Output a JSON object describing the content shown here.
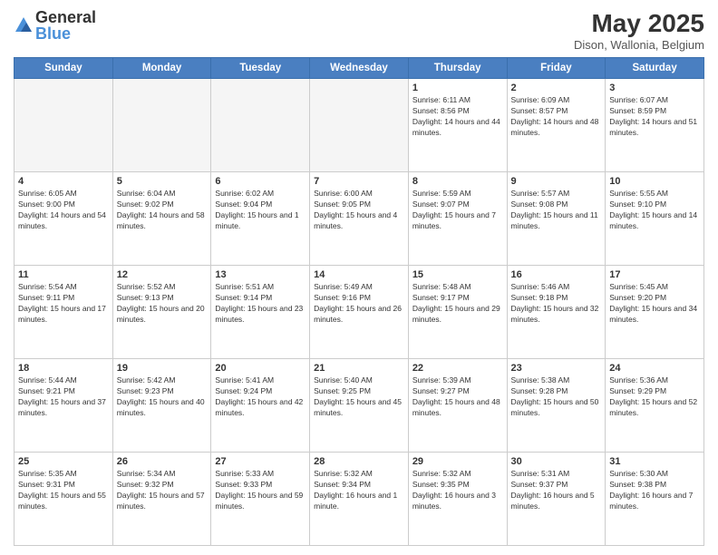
{
  "header": {
    "logo_general": "General",
    "logo_blue": "Blue",
    "month_title": "May 2025",
    "location": "Dison, Wallonia, Belgium"
  },
  "days_of_week": [
    "Sunday",
    "Monday",
    "Tuesday",
    "Wednesday",
    "Thursday",
    "Friday",
    "Saturday"
  ],
  "weeks": [
    [
      {
        "day": "",
        "info": ""
      },
      {
        "day": "",
        "info": ""
      },
      {
        "day": "",
        "info": ""
      },
      {
        "day": "",
        "info": ""
      },
      {
        "day": "1",
        "info": "Sunrise: 6:11 AM\nSunset: 8:56 PM\nDaylight: 14 hours and 44 minutes."
      },
      {
        "day": "2",
        "info": "Sunrise: 6:09 AM\nSunset: 8:57 PM\nDaylight: 14 hours and 48 minutes."
      },
      {
        "day": "3",
        "info": "Sunrise: 6:07 AM\nSunset: 8:59 PM\nDaylight: 14 hours and 51 minutes."
      }
    ],
    [
      {
        "day": "4",
        "info": "Sunrise: 6:05 AM\nSunset: 9:00 PM\nDaylight: 14 hours and 54 minutes."
      },
      {
        "day": "5",
        "info": "Sunrise: 6:04 AM\nSunset: 9:02 PM\nDaylight: 14 hours and 58 minutes."
      },
      {
        "day": "6",
        "info": "Sunrise: 6:02 AM\nSunset: 9:04 PM\nDaylight: 15 hours and 1 minute."
      },
      {
        "day": "7",
        "info": "Sunrise: 6:00 AM\nSunset: 9:05 PM\nDaylight: 15 hours and 4 minutes."
      },
      {
        "day": "8",
        "info": "Sunrise: 5:59 AM\nSunset: 9:07 PM\nDaylight: 15 hours and 7 minutes."
      },
      {
        "day": "9",
        "info": "Sunrise: 5:57 AM\nSunset: 9:08 PM\nDaylight: 15 hours and 11 minutes."
      },
      {
        "day": "10",
        "info": "Sunrise: 5:55 AM\nSunset: 9:10 PM\nDaylight: 15 hours and 14 minutes."
      }
    ],
    [
      {
        "day": "11",
        "info": "Sunrise: 5:54 AM\nSunset: 9:11 PM\nDaylight: 15 hours and 17 minutes."
      },
      {
        "day": "12",
        "info": "Sunrise: 5:52 AM\nSunset: 9:13 PM\nDaylight: 15 hours and 20 minutes."
      },
      {
        "day": "13",
        "info": "Sunrise: 5:51 AM\nSunset: 9:14 PM\nDaylight: 15 hours and 23 minutes."
      },
      {
        "day": "14",
        "info": "Sunrise: 5:49 AM\nSunset: 9:16 PM\nDaylight: 15 hours and 26 minutes."
      },
      {
        "day": "15",
        "info": "Sunrise: 5:48 AM\nSunset: 9:17 PM\nDaylight: 15 hours and 29 minutes."
      },
      {
        "day": "16",
        "info": "Sunrise: 5:46 AM\nSunset: 9:18 PM\nDaylight: 15 hours and 32 minutes."
      },
      {
        "day": "17",
        "info": "Sunrise: 5:45 AM\nSunset: 9:20 PM\nDaylight: 15 hours and 34 minutes."
      }
    ],
    [
      {
        "day": "18",
        "info": "Sunrise: 5:44 AM\nSunset: 9:21 PM\nDaylight: 15 hours and 37 minutes."
      },
      {
        "day": "19",
        "info": "Sunrise: 5:42 AM\nSunset: 9:23 PM\nDaylight: 15 hours and 40 minutes."
      },
      {
        "day": "20",
        "info": "Sunrise: 5:41 AM\nSunset: 9:24 PM\nDaylight: 15 hours and 42 minutes."
      },
      {
        "day": "21",
        "info": "Sunrise: 5:40 AM\nSunset: 9:25 PM\nDaylight: 15 hours and 45 minutes."
      },
      {
        "day": "22",
        "info": "Sunrise: 5:39 AM\nSunset: 9:27 PM\nDaylight: 15 hours and 48 minutes."
      },
      {
        "day": "23",
        "info": "Sunrise: 5:38 AM\nSunset: 9:28 PM\nDaylight: 15 hours and 50 minutes."
      },
      {
        "day": "24",
        "info": "Sunrise: 5:36 AM\nSunset: 9:29 PM\nDaylight: 15 hours and 52 minutes."
      }
    ],
    [
      {
        "day": "25",
        "info": "Sunrise: 5:35 AM\nSunset: 9:31 PM\nDaylight: 15 hours and 55 minutes."
      },
      {
        "day": "26",
        "info": "Sunrise: 5:34 AM\nSunset: 9:32 PM\nDaylight: 15 hours and 57 minutes."
      },
      {
        "day": "27",
        "info": "Sunrise: 5:33 AM\nSunset: 9:33 PM\nDaylight: 15 hours and 59 minutes."
      },
      {
        "day": "28",
        "info": "Sunrise: 5:32 AM\nSunset: 9:34 PM\nDaylight: 16 hours and 1 minute."
      },
      {
        "day": "29",
        "info": "Sunrise: 5:32 AM\nSunset: 9:35 PM\nDaylight: 16 hours and 3 minutes."
      },
      {
        "day": "30",
        "info": "Sunrise: 5:31 AM\nSunset: 9:37 PM\nDaylight: 16 hours and 5 minutes."
      },
      {
        "day": "31",
        "info": "Sunrise: 5:30 AM\nSunset: 9:38 PM\nDaylight: 16 hours and 7 minutes."
      }
    ]
  ]
}
